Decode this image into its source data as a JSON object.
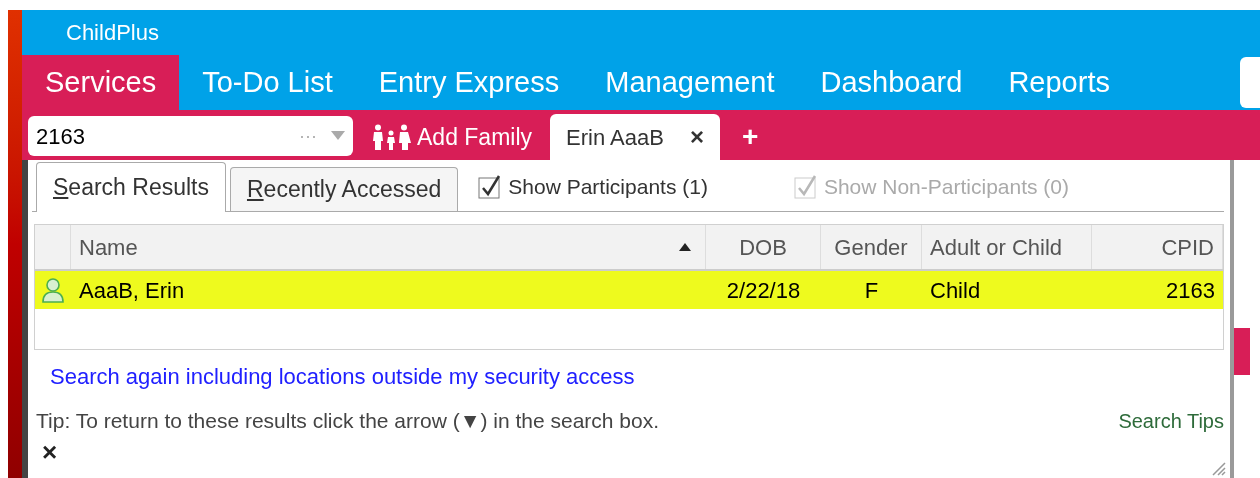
{
  "app": {
    "title": "ChildPlus"
  },
  "nav": [
    {
      "label": "Services",
      "selected": true
    },
    {
      "label": "To-Do List",
      "selected": false
    },
    {
      "label": "Entry Express",
      "selected": false
    },
    {
      "label": "Management",
      "selected": false
    },
    {
      "label": "Dashboard",
      "selected": false
    },
    {
      "label": "Reports",
      "selected": false
    }
  ],
  "search": {
    "value": "2163",
    "more": "···"
  },
  "add_family": {
    "label": "Add Family"
  },
  "open_tabs": [
    {
      "label": "Erin AaaB",
      "close": "×"
    }
  ],
  "new_tab": "+",
  "results_tabs": [
    {
      "label": "Search Results",
      "selected": true
    },
    {
      "label": "Recently Accessed",
      "selected": false
    }
  ],
  "filters": [
    {
      "label": "Show Participants (1)",
      "checked": true,
      "disabled": false
    },
    {
      "label": "Show Non-Participants (0)",
      "checked": true,
      "disabled": true
    }
  ],
  "table": {
    "columns": [
      {
        "label": "Name",
        "sorted_ascending": true
      },
      {
        "label": "DOB"
      },
      {
        "label": "Gender"
      },
      {
        "label": "Adult or Child"
      },
      {
        "label": "CPID"
      }
    ],
    "rows": [
      {
        "selected": true,
        "cells": [
          "AaaB, Erin",
          "2/22/18",
          "F",
          "Child",
          "2163"
        ]
      }
    ]
  },
  "link": "Search again including locations outside my security access",
  "tip": "Tip: To return to these results click the arrow (▼) in the search box.",
  "search_tips": "Search Tips",
  "close": "×"
}
